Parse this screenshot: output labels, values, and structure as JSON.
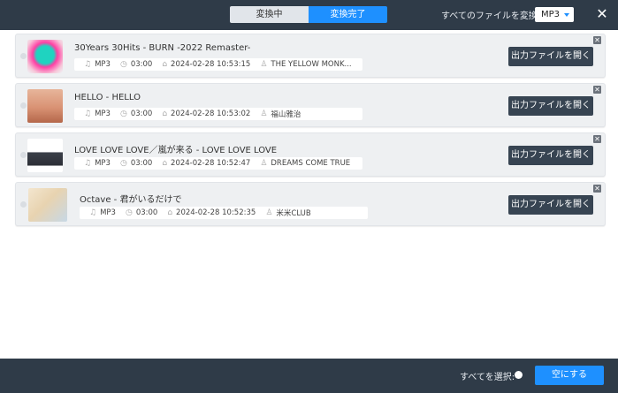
{
  "header": {
    "tab_converting": "変換中",
    "tab_done": "変換完了",
    "convert_all_label": "すべてのファイルを変換:",
    "format_value": "MP3"
  },
  "items": [
    {
      "title": "30Years 30Hits - BURN -2022 Remaster-",
      "format": "MP3",
      "duration": "03:00",
      "date": "2024-02-28 10:53:15",
      "artist": "THE YELLOW MONK...",
      "button": "出力ファイルを開く"
    },
    {
      "title": "HELLO - HELLO",
      "format": "MP3",
      "duration": "03:00",
      "date": "2024-02-28 10:53:02",
      "artist": "福山雅治",
      "button": "出力ファイルを開く"
    },
    {
      "title": "LOVE LOVE LOVE／嵐が来る - LOVE LOVE LOVE",
      "format": "MP3",
      "duration": "03:00",
      "date": "2024-02-28 10:52:47",
      "artist": "DREAMS COME TRUE",
      "button": "出力ファイルを開く"
    },
    {
      "title": "Octave - 君がいるだけで",
      "format": "MP3",
      "duration": "03:00",
      "date": "2024-02-28 10:52:35",
      "artist": "米米CLUB",
      "button": "出力ファイルを開く"
    }
  ],
  "footer": {
    "select_all_label": "すべてを選択:",
    "clear_button": "空にする"
  }
}
